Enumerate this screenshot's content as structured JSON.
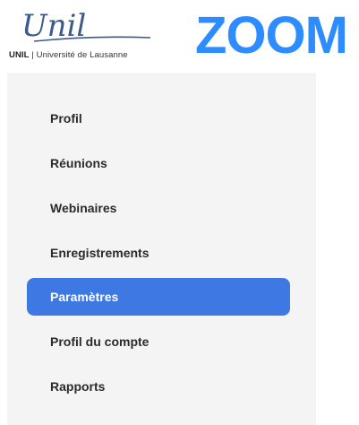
{
  "brand": {
    "unil_script": "Unil",
    "unil_abbrev": "UNIL",
    "unil_separator": " | ",
    "unil_name": "Université de Lausanne",
    "zoom_wordmark": "ZOOM",
    "zoom_color": "#2d8cff"
  },
  "sidebar": {
    "active_color": "#3d78e3",
    "items": [
      {
        "label": "Profil",
        "active": false
      },
      {
        "label": "Réunions",
        "active": false
      },
      {
        "label": "Webinaires",
        "active": false
      },
      {
        "label": "Enregistrements",
        "active": false
      },
      {
        "label": "Paramètres",
        "active": true
      },
      {
        "label": "Profil du compte",
        "active": false
      },
      {
        "label": "Rapports",
        "active": false
      }
    ]
  }
}
